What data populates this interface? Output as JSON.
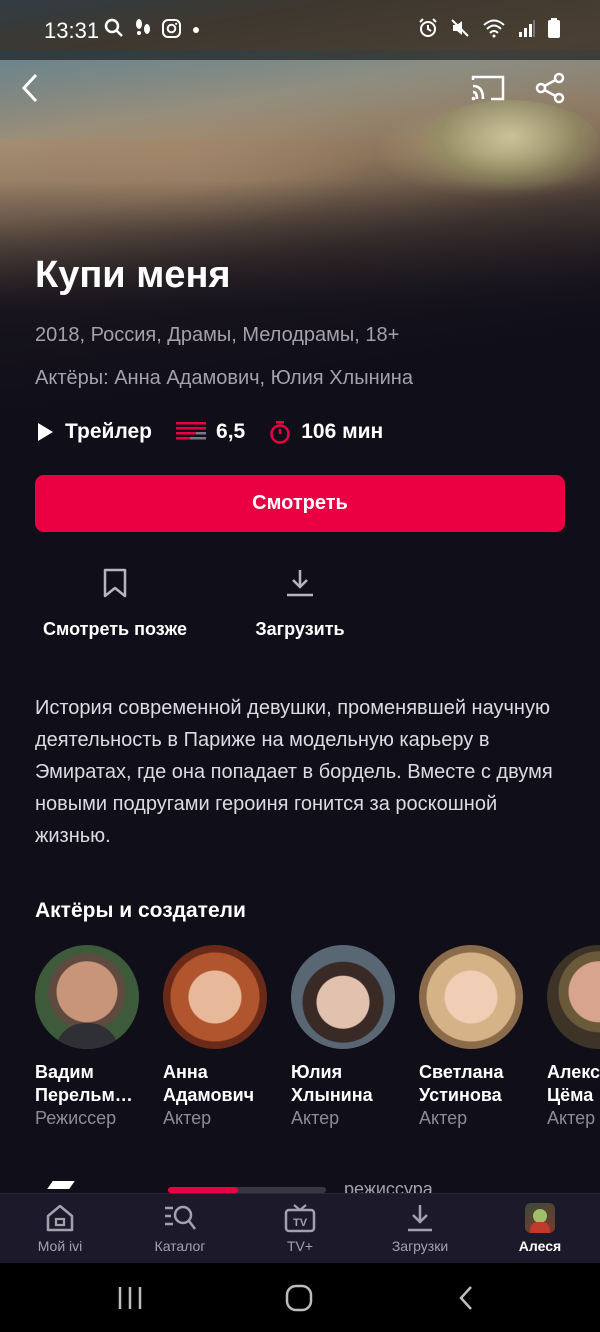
{
  "status_bar": {
    "time": "13:31",
    "left_icons": [
      "search-icon",
      "steps-icon",
      "instagram-icon",
      "dot-icon"
    ],
    "right_icons": [
      "alarm-icon",
      "mute-icon",
      "wifi-icon",
      "signal-icon",
      "battery-icon"
    ]
  },
  "header": {
    "back_icon": "chevron-left-icon",
    "cast_icon": "cast-icon",
    "share_icon": "share-icon"
  },
  "movie": {
    "title": "Купи меня",
    "meta": "2018, Россия, Драмы, Мелодрамы, 18+",
    "actors_line": "Актёры: Анна Адамович, Юлия Хлынина",
    "trailer_label": "Трейлер",
    "rating": "6,5",
    "duration": "106 мин",
    "description": "История современной девушки, променявшей научную деятельность в Париже на модельную карьеру в Эмиратах, где она попадает в бордель. Вместе с двумя новыми подругами героиня гонится за роскошной жизнью."
  },
  "actions": {
    "watch_label": "Смотреть",
    "watch_later_label": "Смотреть позже",
    "download_label": "Загрузить"
  },
  "people_section": {
    "title": "Актёры и создатели",
    "people": [
      {
        "name": "Вадим\nПерельм…",
        "role": "Режиссер"
      },
      {
        "name": "Анна\nАдамович",
        "role": "Актер"
      },
      {
        "name": "Юлия\nХлынина",
        "role": "Актер"
      },
      {
        "name": "Светлана\nУстинова",
        "role": "Актер"
      },
      {
        "name": "Алекс\nЦёма",
        "role": "Актер"
      }
    ]
  },
  "partial_row": {
    "text": "режиссура",
    "progress": 0.44
  },
  "tabbar": {
    "tabs": [
      {
        "label": "Мой ivi",
        "icon": "home-icon"
      },
      {
        "label": "Каталог",
        "icon": "catalog-search-icon"
      },
      {
        "label": "TV+",
        "icon": "tv-icon"
      },
      {
        "label": "Загрузки",
        "icon": "download-icon"
      },
      {
        "label": "Алеся",
        "icon": "profile-avatar"
      }
    ],
    "active_index": 4
  },
  "colors": {
    "accent": "#ea0042",
    "background": "#100e19",
    "tabbar": "#1c1a2a",
    "secondary_text": "#a4a1ad"
  }
}
